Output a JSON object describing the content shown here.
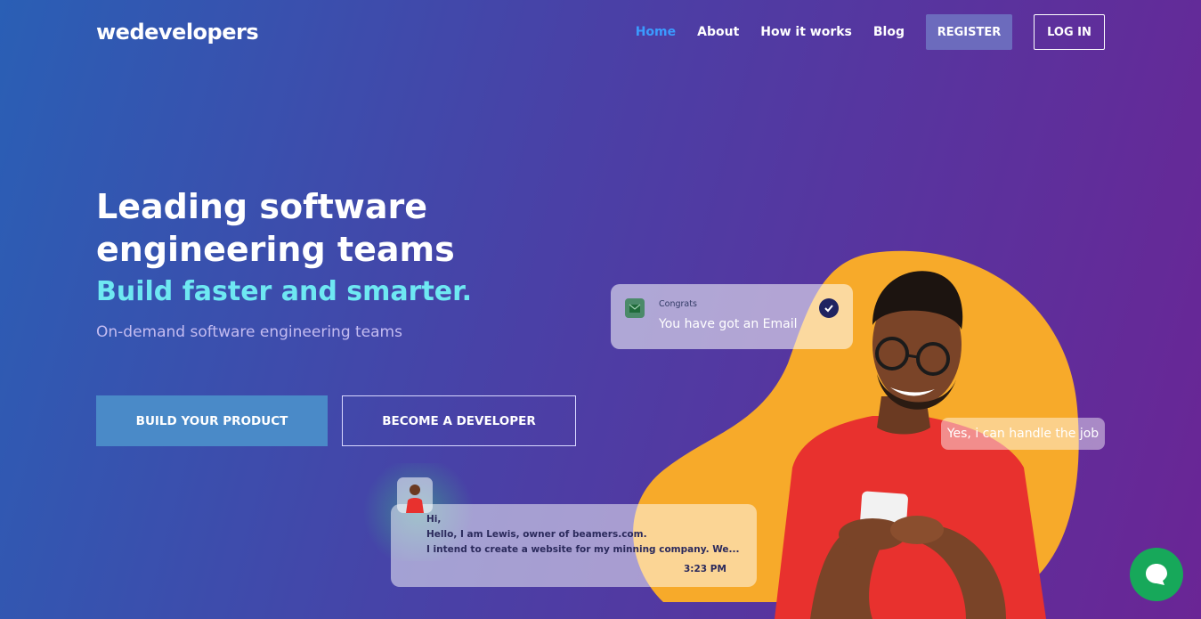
{
  "brand": {
    "logo": "wedevelopers"
  },
  "nav": {
    "links": [
      {
        "label": "Home",
        "active": true
      },
      {
        "label": "About",
        "active": false
      },
      {
        "label": "How it works",
        "active": false
      },
      {
        "label": "Blog",
        "active": false
      }
    ],
    "register_label": "REGISTER",
    "login_label": "LOG IN"
  },
  "hero": {
    "title": "Leading software engineering teams",
    "subtitle": "Build faster and smarter.",
    "description": "On-demand software engineering teams",
    "build_button": "BUILD YOUR PRODUCT",
    "developer_button": "BECOME A DEVELOPER"
  },
  "email_card": {
    "label": "Congrats",
    "message": "You have got an Email",
    "icon": "mail-icon",
    "status_icon": "check-icon"
  },
  "reply_bubble": {
    "text": "Yes, i can handle the job"
  },
  "chat_card": {
    "lines": [
      "Hi,",
      "Hello, I am Lewis, owner of beamers.com.",
      "I intend to create a website for my minning company. We..."
    ],
    "time": "3:23 PM"
  },
  "colors": {
    "accent_cyan": "#6ee8f2",
    "nav_active": "#3b9bff",
    "blob": "#f7aa2a",
    "shirt": "#e8312e",
    "chat_widget": "#17a85a"
  }
}
